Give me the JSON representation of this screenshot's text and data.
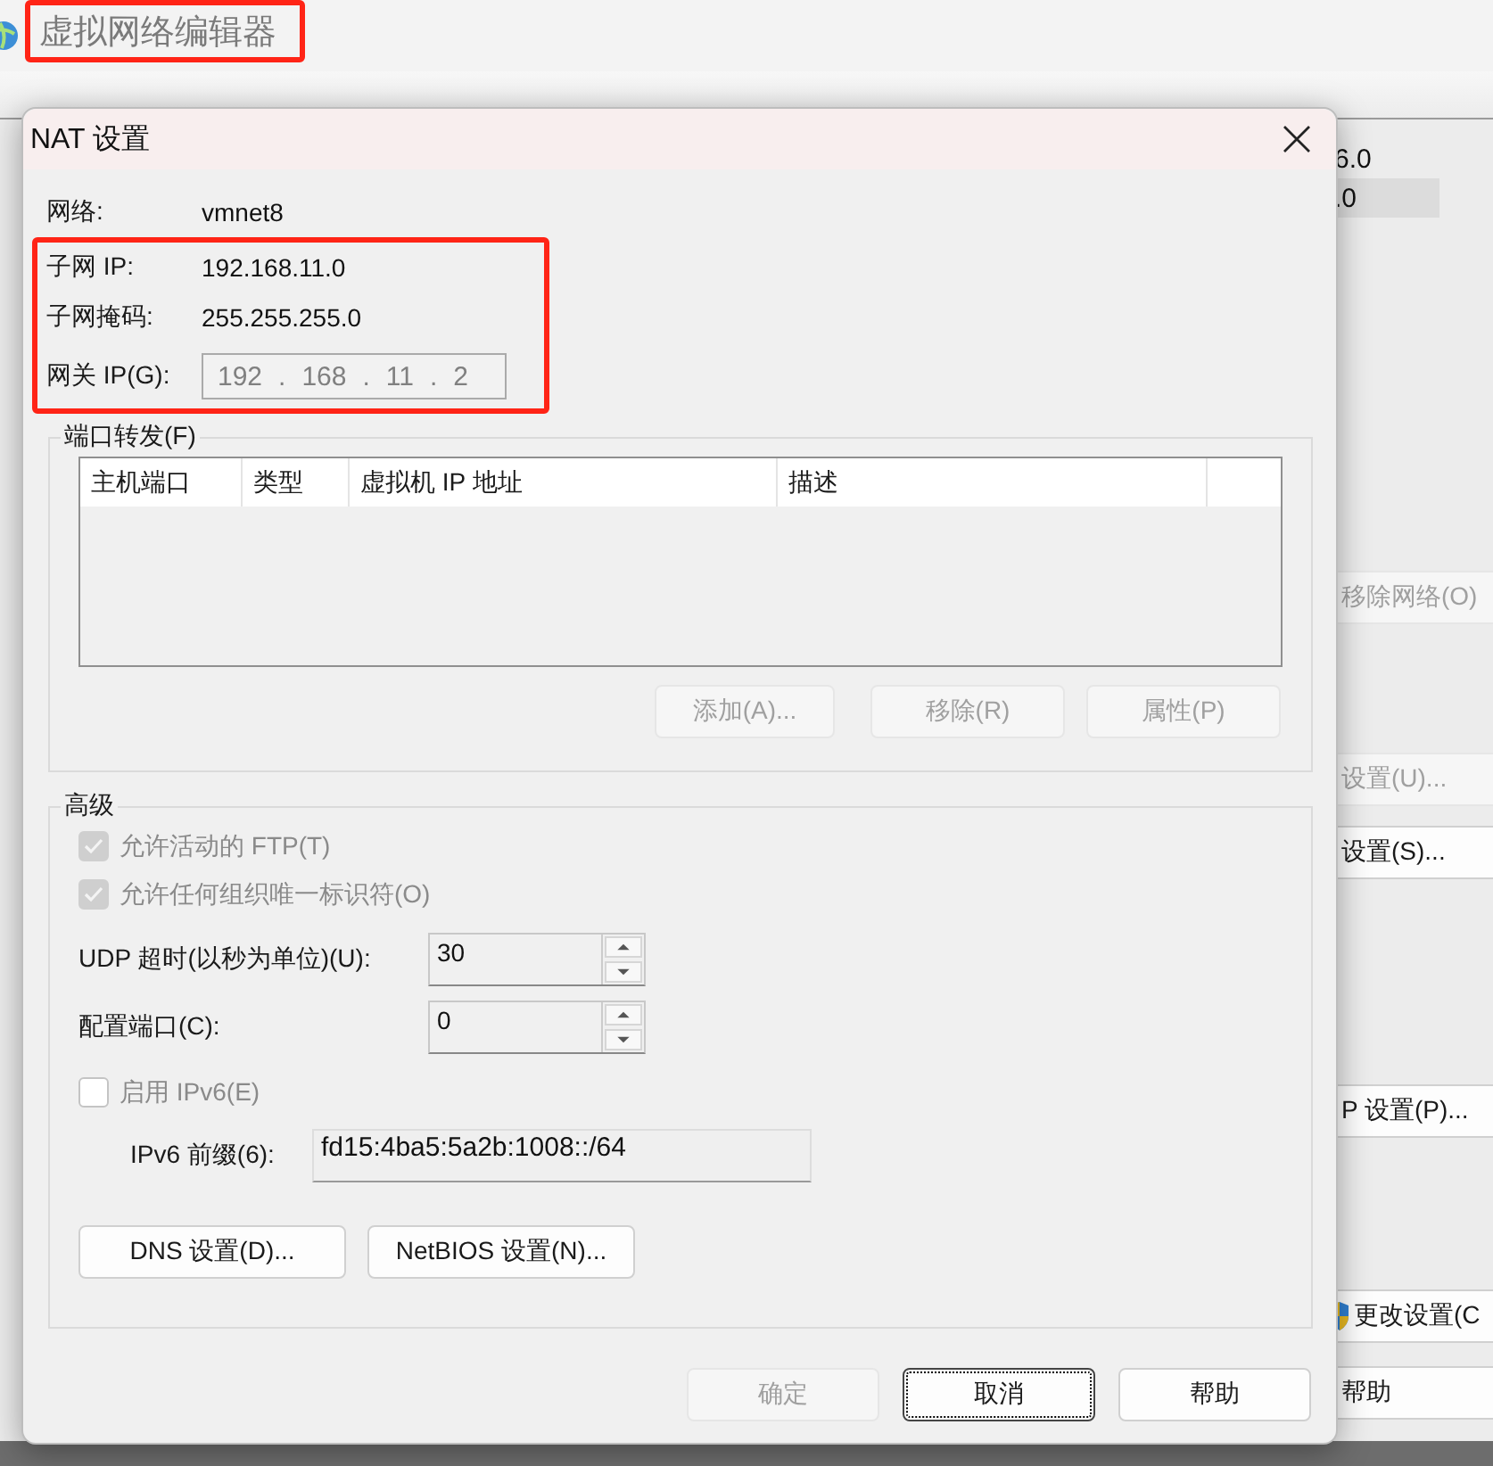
{
  "background_window": {
    "title": "虚拟网络编辑器",
    "table_cells": [
      {
        "text": "6.0",
        "selected": false
      },
      {
        "text": ".0",
        "selected": true
      }
    ],
    "buttons": [
      {
        "label": "移除网络(O)",
        "disabled": true,
        "kind": "plain"
      },
      {
        "label": "设置(U)...",
        "disabled": true,
        "kind": "plain"
      },
      {
        "label": "设置(S)...",
        "disabled": false,
        "kind": "plain"
      },
      {
        "label": "P 设置(P)...",
        "disabled": false,
        "kind": "plain"
      },
      {
        "label": "更改设置(C",
        "disabled": false,
        "kind": "shield"
      },
      {
        "label": "帮助",
        "disabled": false,
        "kind": "plain"
      }
    ]
  },
  "dialog": {
    "title": "NAT 设置",
    "info": [
      {
        "label": "网络:",
        "value": "vmnet8"
      },
      {
        "label": "子网 IP:",
        "value": "192.168.11.0"
      },
      {
        "label": "子网掩码:",
        "value": "255.255.255.0"
      }
    ],
    "gateway": {
      "label": "网关 IP(G):",
      "octets": [
        "192",
        "168",
        "11",
        "2"
      ],
      "separator": "."
    },
    "port_forwarding": {
      "title": "端口转发(F)",
      "columns": [
        "主机端口",
        "类型",
        "虚拟机 IP 地址",
        "描述"
      ],
      "buttons": [
        {
          "label": "添加(A)...",
          "disabled": true
        },
        {
          "label": "移除(R)",
          "disabled": true
        },
        {
          "label": "属性(P)",
          "disabled": true
        }
      ]
    },
    "advanced": {
      "title": "高级",
      "items": [
        {
          "kind": "checkbox",
          "label": "允许活动的 FTP(T)",
          "checked": true,
          "disabled": true
        },
        {
          "kind": "checkbox",
          "label": "允许任何组织唯一标识符(O)",
          "checked": true,
          "disabled": true
        },
        {
          "kind": "spinner",
          "label": "UDP 超时(以秒为单位)(U):",
          "value": "30"
        },
        {
          "kind": "spinner",
          "label": "配置端口(C):",
          "value": "0"
        },
        {
          "kind": "checkbox",
          "label": "启用 IPv6(E)",
          "checked": false,
          "disabled": true
        },
        {
          "kind": "field",
          "label": "IPv6 前缀(6):",
          "value": "fd15:4ba5:5a2b:1008::/64"
        }
      ],
      "buttons": [
        "DNS 设置(D)...",
        "NetBIOS 设置(N)..."
      ]
    },
    "footer_buttons": [
      {
        "label": "确定",
        "disabled": true,
        "focused": false
      },
      {
        "label": "取消",
        "disabled": false,
        "focused": true
      },
      {
        "label": "帮助",
        "disabled": false,
        "focused": false
      }
    ]
  }
}
